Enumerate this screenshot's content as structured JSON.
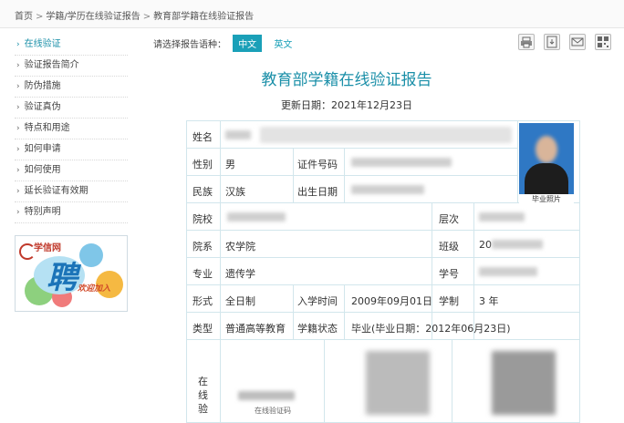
{
  "breadcrumb": [
    "首页",
    "学籍/学历在线验证报告",
    "教育部学籍在线验证报告"
  ],
  "sidebar": {
    "items": [
      {
        "label": "在线验证",
        "active": true
      },
      {
        "label": "验证报告简介",
        "active": false
      },
      {
        "label": "防伪措施",
        "active": false
      },
      {
        "label": "验证真伪",
        "active": false
      },
      {
        "label": "特点和用途",
        "active": false
      },
      {
        "label": "如何申请",
        "active": false
      },
      {
        "label": "如何使用",
        "active": false
      },
      {
        "label": "延长验证有效期",
        "active": false
      },
      {
        "label": "特别声明",
        "active": false
      }
    ]
  },
  "banner": {
    "logo": "学信网",
    "big": "聘",
    "sub": "欢迎加入"
  },
  "lang": {
    "prompt": "请选择报告语种：",
    "options": [
      "中文",
      "英文"
    ],
    "selected": "中文"
  },
  "toolbar": {
    "icons": [
      "print-icon",
      "download-icon",
      "email-icon",
      "qrcode-icon"
    ]
  },
  "report": {
    "title": "教育部学籍在线验证报告",
    "updated": "更新日期：2021年12月23日",
    "labels": {
      "name": "姓名",
      "gender": "性别",
      "id_number": "证件号码",
      "ethnicity": "民族",
      "birth": "出生日期",
      "school": "院校",
      "level": "层次",
      "department": "院系",
      "class": "班级",
      "major": "专业",
      "student_no": "学号",
      "form": "形式",
      "enroll": "入学时间",
      "duration": "学制",
      "type": "类型",
      "status": "学籍状态",
      "verify": "在\n线\n验"
    },
    "values": {
      "gender": "男",
      "ethnicity": "汉族",
      "department": "农学院",
      "major": "遗传学",
      "form": "全日制",
      "enroll": "2009年09月01日",
      "duration": "3 年",
      "type": "普通高等教育",
      "status": "毕业(毕业日期：2012年06月23日)",
      "class_prefix": "20"
    },
    "photo_caption": "毕业照片",
    "verify_code_label": "在线验证码"
  }
}
